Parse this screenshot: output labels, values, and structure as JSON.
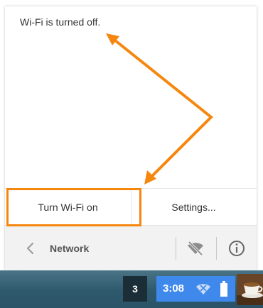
{
  "panel": {
    "status_message": "Wi-Fi is turned off."
  },
  "actions": {
    "turn_wifi_on_label": "Turn Wi-Fi on",
    "settings_label": "Settings..."
  },
  "network_header": {
    "title": "Network",
    "back_icon": "chevron-left-icon",
    "wifi_toggle_icon": "wifi-off-icon",
    "info_icon": "info-icon"
  },
  "shelf": {
    "badge_number": "3",
    "time": "3:08",
    "wifi_icon": "wifi-off-icon",
    "battery_icon": "battery-icon",
    "tray_color": "#3f89ec"
  },
  "annotation": {
    "color": "#f5870f"
  }
}
